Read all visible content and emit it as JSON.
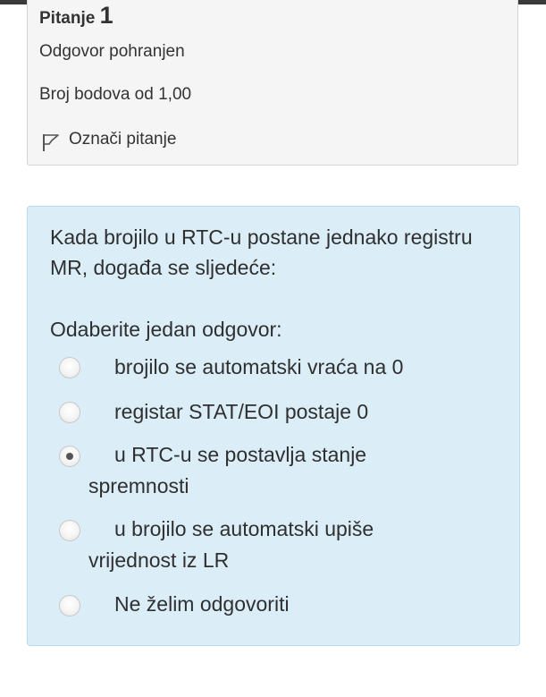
{
  "question_info": {
    "label": "Pitanje",
    "number": "1",
    "state": "Odgovor pohranjen",
    "grade": "Broj bodova od 1,00",
    "flag_label": "Označi pitanje"
  },
  "question": {
    "text": "Kada brojilo u RTC-u postane jednako registru MR, događa se sljedeće:",
    "prompt": "Odaberite jedan odgovor:",
    "options": [
      {
        "label": "brojilo se automatski vraća na 0",
        "selected": false
      },
      {
        "label": "registar STAT/EOI postaje 0",
        "selected": false
      },
      {
        "label": "u RTC-u se postavlja stanje spremnosti",
        "selected": true
      },
      {
        "label": "u brojilo se automatski upiše vrijednost iz LR",
        "selected": false
      },
      {
        "label": "Ne želim odgovoriti",
        "selected": false
      }
    ]
  },
  "icons": {
    "flag": "flag-icon"
  }
}
